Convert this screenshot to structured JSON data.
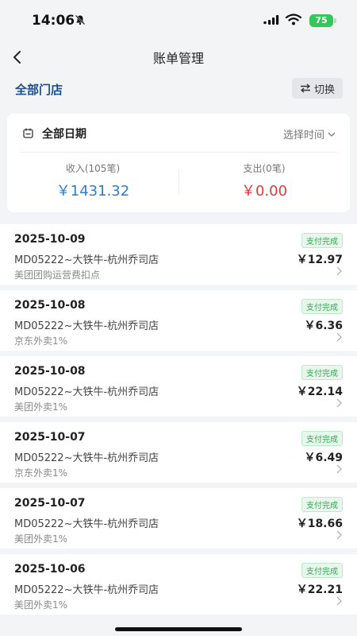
{
  "status": {
    "time": "14:06",
    "battery": "75"
  },
  "nav": {
    "title": "账单管理"
  },
  "store": {
    "name": "全部门店",
    "switch_label": "切换"
  },
  "summary": {
    "date_label": "全部日期",
    "select_time": "选择时间",
    "income_label": "收入(105笔)",
    "income_value": "￥1431.32",
    "expense_label": "支出(0笔)",
    "expense_value": "￥0.00"
  },
  "bills": [
    {
      "date": "2025-10-09",
      "store": "MD05222~大铁牛-杭州乔司店",
      "desc": "美团团购运营费扣点",
      "status": "支付完成",
      "amount": "￥12.97"
    },
    {
      "date": "2025-10-08",
      "store": "MD05222~大铁牛-杭州乔司店",
      "desc": "京东外卖1%",
      "status": "支付完成",
      "amount": "￥6.36"
    },
    {
      "date": "2025-10-08",
      "store": "MD05222~大铁牛-杭州乔司店",
      "desc": "美团外卖1%",
      "status": "支付完成",
      "amount": "￥22.14"
    },
    {
      "date": "2025-10-07",
      "store": "MD05222~大铁牛-杭州乔司店",
      "desc": "京东外卖1%",
      "status": "支付完成",
      "amount": "￥6.49"
    },
    {
      "date": "2025-10-07",
      "store": "MD05222~大铁牛-杭州乔司店",
      "desc": "美团外卖1%",
      "status": "支付完成",
      "amount": "￥18.66"
    },
    {
      "date": "2025-10-06",
      "store": "MD05222~大铁牛-杭州乔司店",
      "desc": "美团外卖1%",
      "status": "支付完成",
      "amount": "￥22.21"
    }
  ],
  "colors": {
    "accent": "#2f7dd1",
    "expense": "#e23b3b",
    "status_green": "#33a853"
  }
}
